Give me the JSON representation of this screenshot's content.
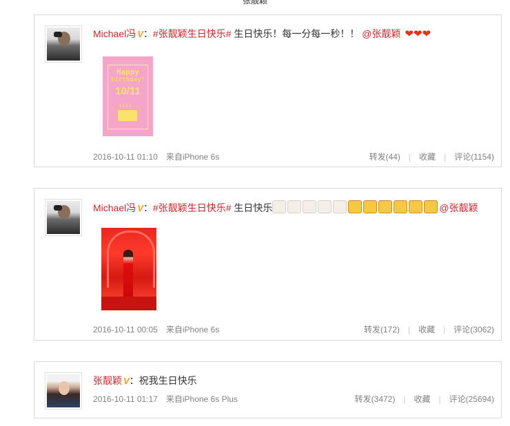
{
  "page": {
    "title": "张靓颖"
  },
  "posts": [
    {
      "author": "Michael冯",
      "vip_badge": "V",
      "colon": "：",
      "topic": "#张靓颖生日快乐#",
      "text": " 生日快乐！每一分每一秒！！",
      "mention": "@张靓颖",
      "hearts": "❤❤❤",
      "image": {
        "line1": "Happy",
        "line2": "birthday!",
        "line3": "10/11",
        "candles": "ıııı"
      },
      "time": "2016-10-11 01:10",
      "source": "来自iPhone 6s",
      "repost_label": "转发(44)",
      "favorite_label": "收藏",
      "comment_label": "评论(1154)"
    },
    {
      "author": "Michael冯",
      "vip_badge": "V",
      "colon": "：",
      "topic": "#张靓颖生日快乐#",
      "text": " 生日快乐",
      "emoji_cakes": 5,
      "emoji_gifts": 6,
      "mention": "@张靓颖",
      "time": "2016-10-11 00:05",
      "source": "来自iPhone 6s",
      "repost_label": "转发(172)",
      "favorite_label": "收藏",
      "comment_label": "评论(3062)"
    },
    {
      "author": "张靓颖",
      "vip_badge": "V",
      "colon": "：",
      "text": "祝我生日快乐",
      "time": "2016-10-11 01:17",
      "source": "来自iPhone 6s Plus",
      "repost_label": "转发(3472)",
      "favorite_label": "收藏",
      "comment_label": "评论(25694)"
    }
  ],
  "separator": "|",
  "colors": {
    "name": "#c0272d",
    "vip": "#f49b1a",
    "meta": "#808080",
    "border": "#d9d9d9"
  }
}
